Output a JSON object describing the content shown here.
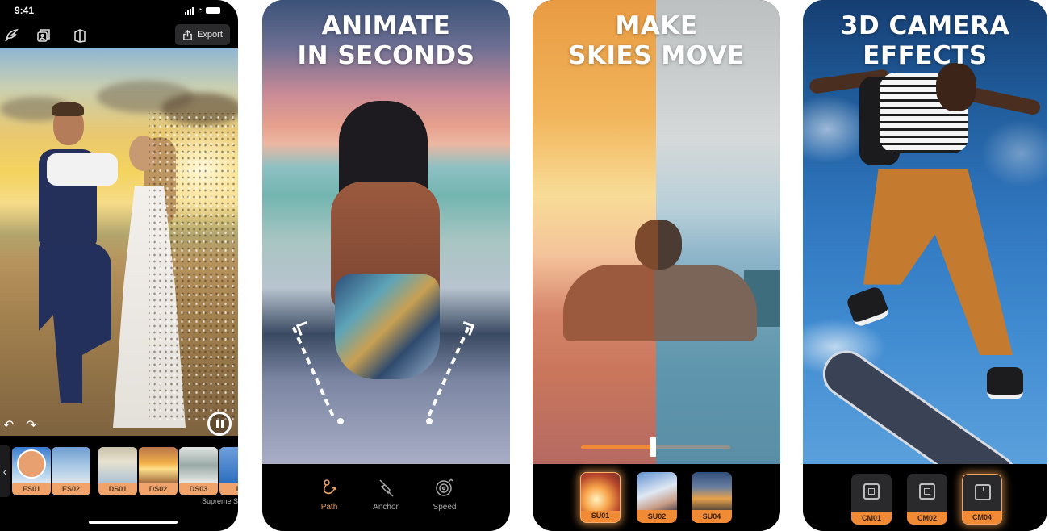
{
  "accent_color": "#f08a35",
  "panels": [
    {
      "id": "editor",
      "status_bar": {
        "time": "9:41"
      },
      "toolbar": {
        "icons": [
          "sky-brush-icon",
          "gallery-icon",
          "overlay-icon"
        ],
        "export_label": "Export",
        "export_icon": "share-icon"
      },
      "playback": {
        "undo_icon": "undo-icon",
        "redo_icon": "redo-icon",
        "pause_icon": "pause-icon"
      },
      "presets": [
        {
          "label": "ES01",
          "selected": true
        },
        {
          "label": "ES02",
          "selected": false
        },
        {
          "label": "DS01",
          "selected": false
        },
        {
          "label": "DS02",
          "selected": false
        },
        {
          "label": "DS03",
          "selected": false
        },
        {
          "label": "D",
          "selected": false
        }
      ],
      "pack_name": "Supreme S"
    },
    {
      "id": "animate",
      "headline": [
        "ANIMATE",
        "IN SECONDS"
      ],
      "tools": [
        {
          "label": "Path",
          "icon": "path-icon",
          "active": true
        },
        {
          "label": "Anchor",
          "icon": "anchor-pin-icon",
          "active": false
        },
        {
          "label": "Speed",
          "icon": "speed-icon",
          "active": false
        }
      ]
    },
    {
      "id": "skies",
      "headline": [
        "MAKE",
        "SKIES MOVE"
      ],
      "comparison_slider": {
        "value_percent": 48
      },
      "skies": [
        {
          "label": "SU01",
          "selected": true
        },
        {
          "label": "SU02",
          "selected": false
        },
        {
          "label": "SU04",
          "selected": false
        }
      ]
    },
    {
      "id": "camera",
      "headline": [
        "3D CAMERA",
        "EFFECTS"
      ],
      "camera_effects": [
        {
          "label": "CM01",
          "selected": false
        },
        {
          "label": "CM02",
          "selected": false
        },
        {
          "label": "CM04",
          "selected": true
        }
      ]
    }
  ]
}
